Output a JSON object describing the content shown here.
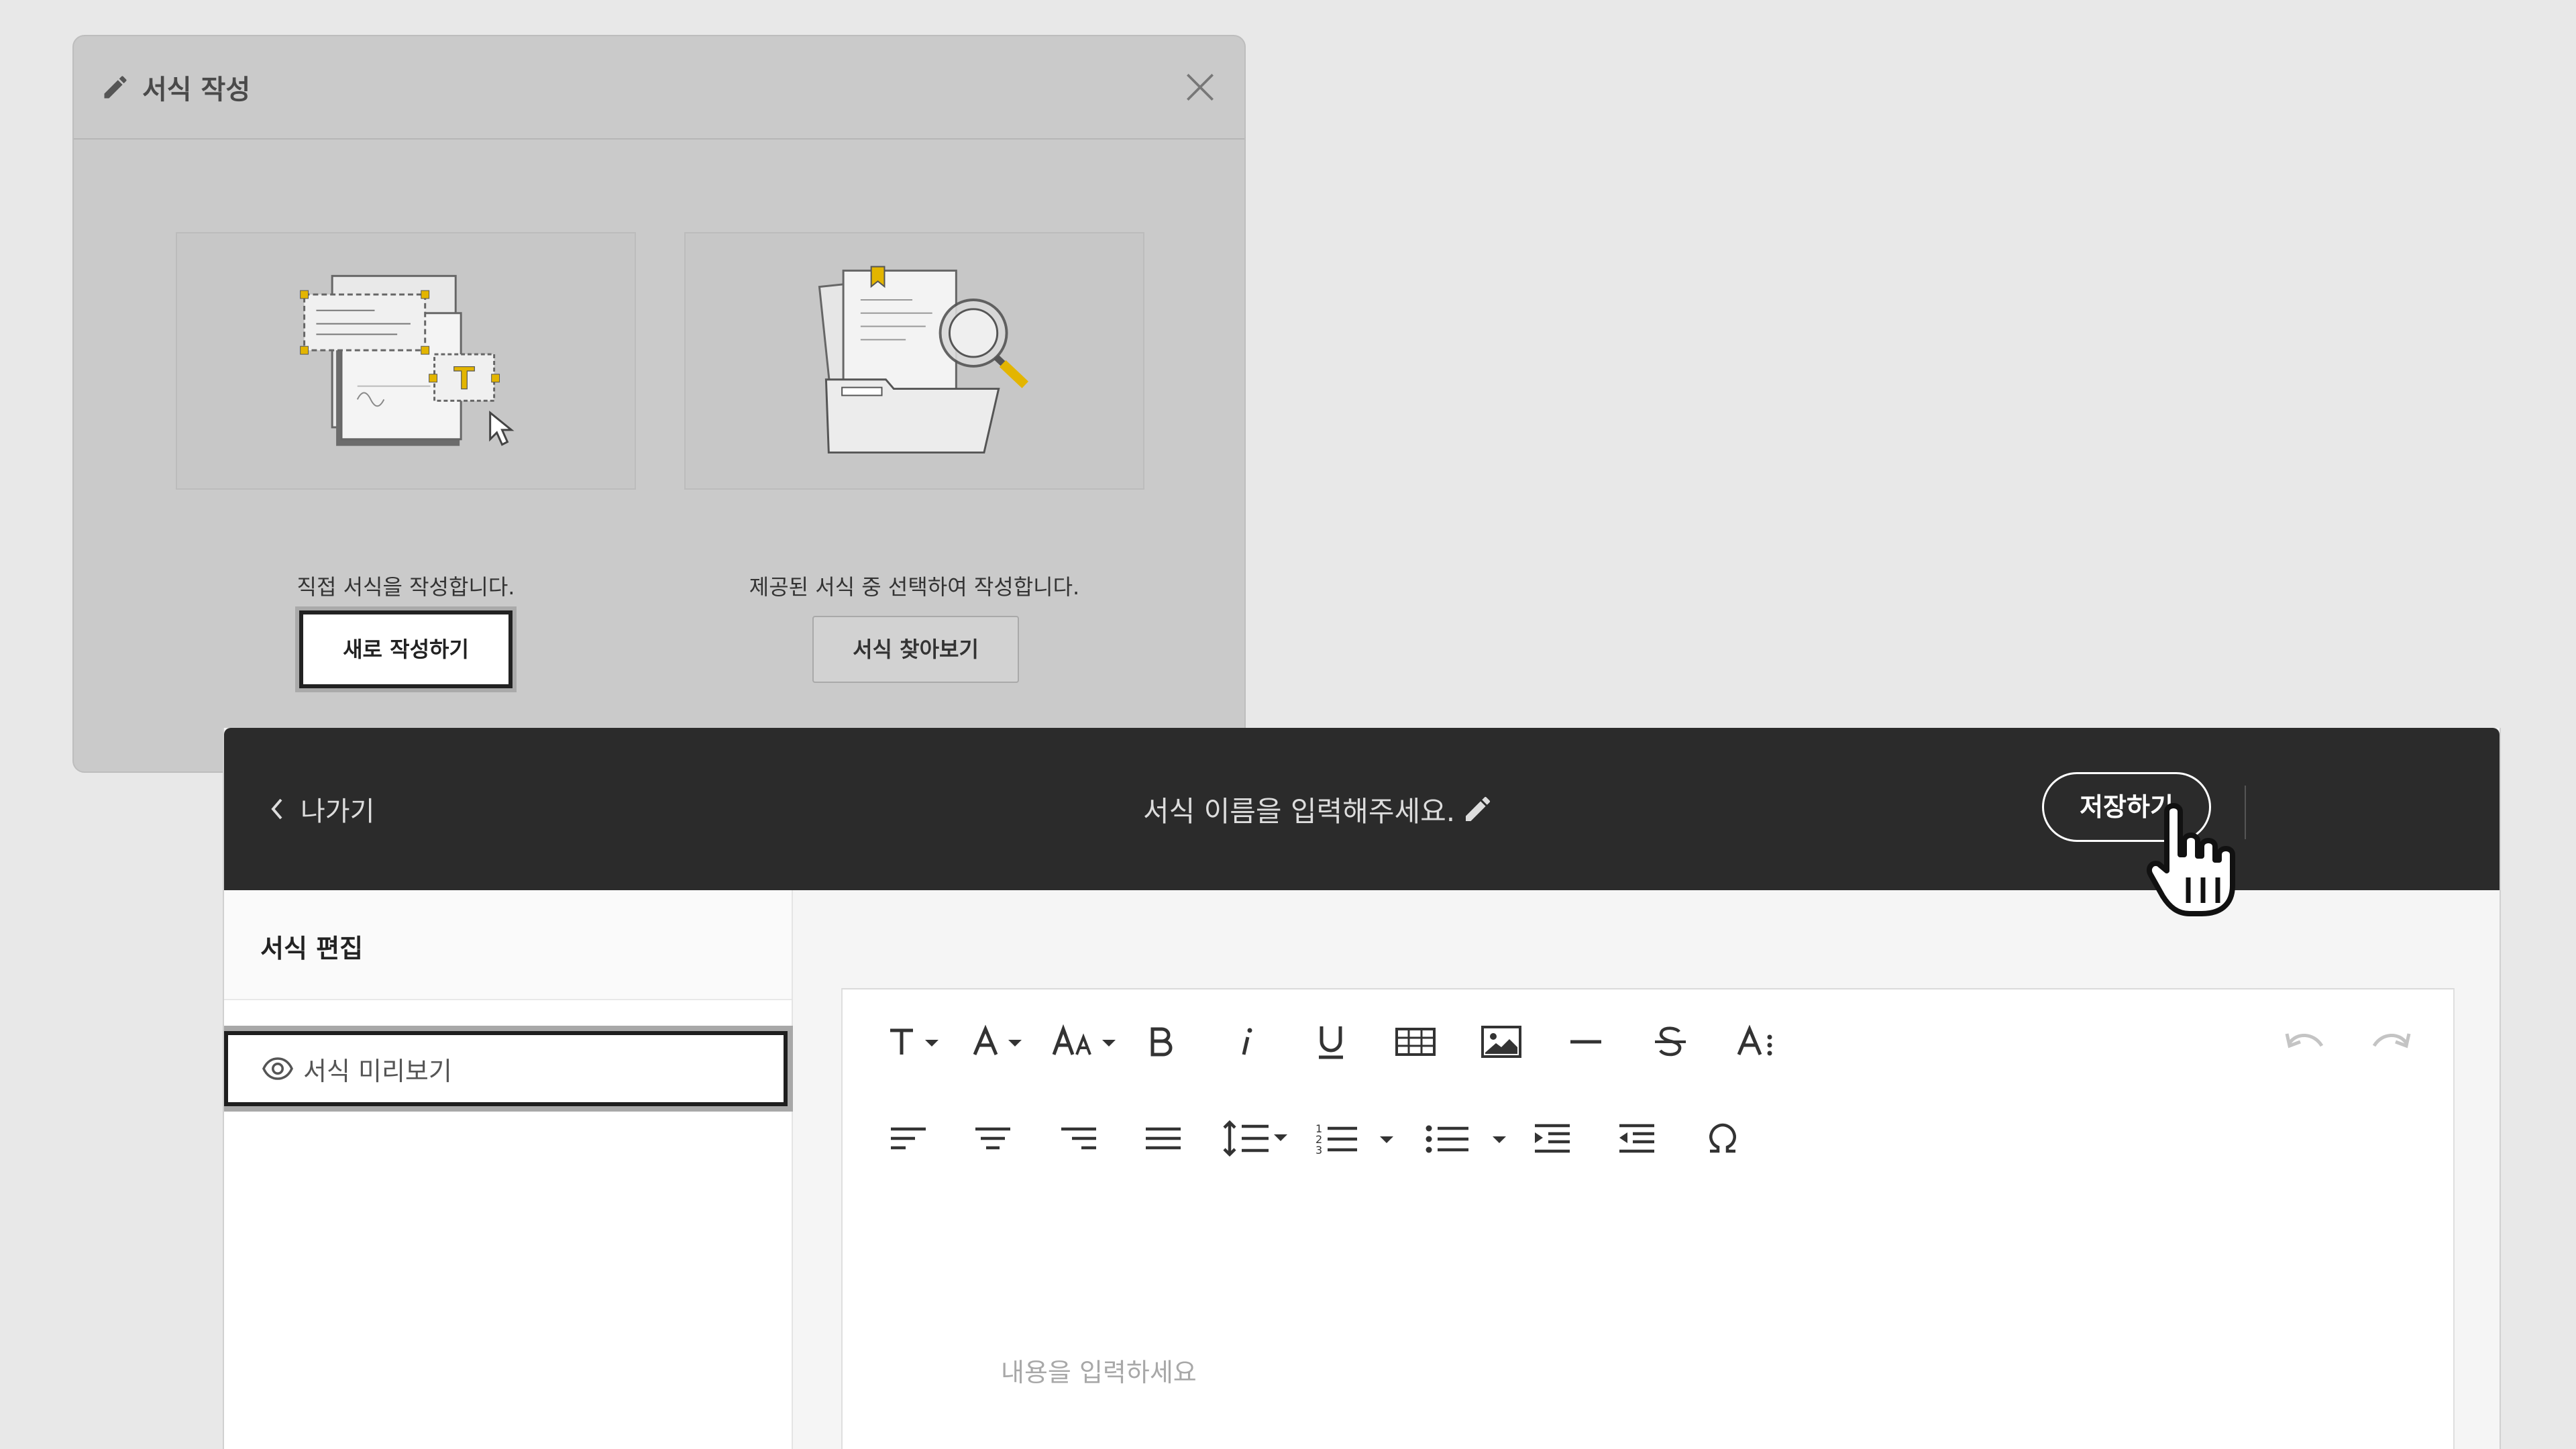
{
  "dialog": {
    "title": "서식 작성",
    "option_direct": {
      "description": "직접 서식을 작성합니다.",
      "button_label": "새로 작성하기"
    },
    "option_template": {
      "description": "제공된 서식 중 선택하여 작성합니다.",
      "button_label": "서식 찾아보기"
    }
  },
  "editor": {
    "back_label": "나가기",
    "title_placeholder": "서식 이름을 입력해주세요.",
    "save_label": "저장하기",
    "sidebar": {
      "title": "서식 편집",
      "preview_label": "서식 미리보기"
    },
    "toolbar": {
      "row1": [
        "text-format-dropdown",
        "font-color-dropdown",
        "font-size-dropdown",
        "bold",
        "italic",
        "underline",
        "table",
        "image",
        "horizontal-rule",
        "strikethrough",
        "more-text-style"
      ],
      "row1_right": [
        "undo",
        "redo"
      ],
      "row2": [
        "align-left",
        "align-center",
        "align-right",
        "align-justify",
        "line-height-dropdown",
        "ordered-list-dropdown",
        "unordered-list-dropdown",
        "indent",
        "outdent",
        "special-characters"
      ]
    },
    "content_placeholder": "내용을 입력하세요"
  },
  "colors": {
    "topbar": "#2b2b2b",
    "dialog_bg": "#cacaca",
    "accent_yellow": "#e3b500"
  }
}
